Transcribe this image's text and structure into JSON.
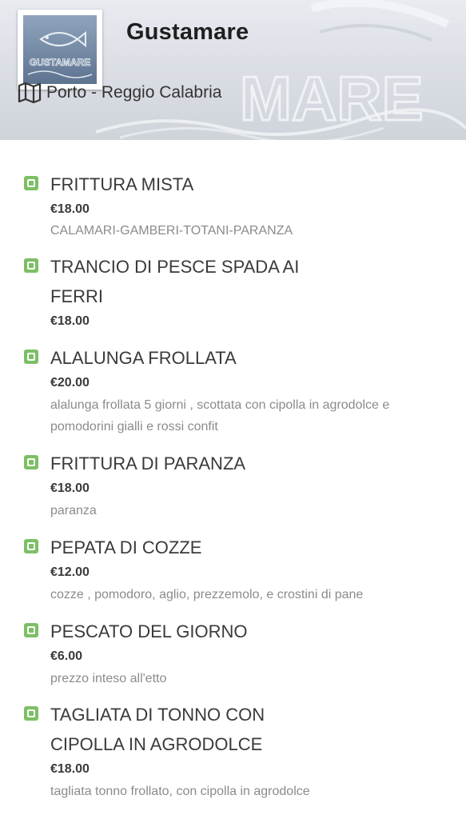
{
  "header": {
    "restaurant_name": "Gustamare",
    "location": "Porto - Reggio Calabria",
    "location_icon": "map-icon",
    "logo_text": "GUSTAMARE",
    "background_text": "MARE"
  },
  "colors": {
    "bullet": "#7cbf65",
    "title_text": "#3a3a3a",
    "description_text": "#8b8b8b"
  },
  "menu_items": [
    {
      "name": "FRITTURA MISTA",
      "price": "€18.00",
      "description": "CALAMARI-GAMBERI-TOTANI-PARANZA"
    },
    {
      "name": "TRANCIO DI PESCE SPADA AI FERRI",
      "price": "€18.00",
      "description": ""
    },
    {
      "name": "ALALUNGA FROLLATA",
      "price": "€20.00",
      "description": "alalunga frollata 5 giorni , scottata con cipolla in agrodolce e pomodorini gialli e rossi confit"
    },
    {
      "name": "FRITTURA DI PARANZA",
      "price": "€18.00",
      "description": "paranza"
    },
    {
      "name": "PEPATA DI COZZE",
      "price": "€12.00",
      "description": "cozze , pomodoro, aglio, prezzemolo, e crostini di pane"
    },
    {
      "name": "PESCATO DEL GIORNO",
      "price": "€6.00",
      "description": "prezzo inteso all'etto"
    },
    {
      "name": "TAGLIATA DI TONNO CON CIPOLLA IN AGRODOLCE",
      "price": "€18.00",
      "description": "tagliata tonno frollato, con cipolla in agrodolce"
    }
  ]
}
